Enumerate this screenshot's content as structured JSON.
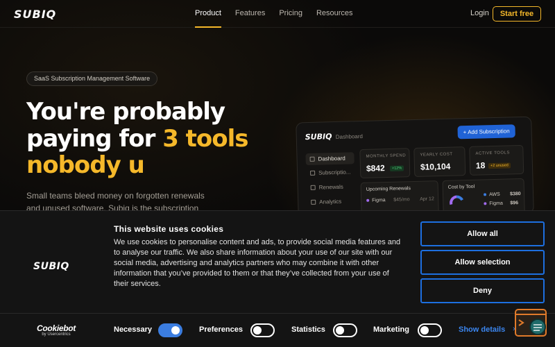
{
  "nav": {
    "logo": "SUBIQ",
    "links": [
      "Product",
      "Features",
      "Pricing",
      "Resources"
    ],
    "active_link": "Product",
    "login": "Login",
    "cta": "Start free"
  },
  "hero": {
    "pill": "SaaS Subscription Management Software",
    "headline_line1": "You're probably",
    "headline_line2_start": "paying for ",
    "headline_line2_highlight": "3 tools",
    "headline_line3": "nobody u",
    "subtext": "Small teams bleed money on forgotten renewals and unused software. Subiq is the subscription"
  },
  "dashboard": {
    "logo": "SUBIQ",
    "title": "Dashboard",
    "add_button": "+ Add Subscription",
    "sidebar": [
      "Dashboard",
      "Subscriptio...",
      "Renewals",
      "Analytics"
    ],
    "cards": [
      {
        "label": "MONTHLY SPEND",
        "value": "$842",
        "badge": "+12%"
      },
      {
        "label": "YEARLY COST",
        "value": "$10,104",
        "badge": ""
      },
      {
        "label": "ACTIVE TOOLS",
        "value": "18",
        "badge": "+2 unused"
      }
    ],
    "upcoming": {
      "title": "Upcoming Renewals",
      "rows": [
        {
          "name": "Figma",
          "price": "$45/mo",
          "date": "Apr 12"
        }
      ]
    },
    "cost_by_tool": {
      "title": "Cost by Tool",
      "rows": [
        {
          "name": "AWS",
          "value": "$380"
        },
        {
          "name": "Figma",
          "value": "$96"
        }
      ]
    }
  },
  "colors": {
    "accent": "#f5b82a",
    "primary_blue": "#1d6fe0",
    "background": "#0b0a09"
  },
  "cookie": {
    "logo": "SUBIQ",
    "title": "This website uses cookies",
    "text": "We use cookies to personalise content and ads, to provide social media features and to analyse our traffic. We also share information about your use of our site with our social media, advertising and analytics partners who may combine it with other information that you’ve provided to them or that they’ve collected from your use of their services.",
    "buttons": {
      "allow_all": "Allow all",
      "allow_selection": "Allow selection",
      "deny": "Deny"
    },
    "cookiebot_main": "Cookiebot",
    "cookiebot_sub": "by Usercentrics",
    "categories": [
      {
        "label": "Necessary",
        "on": true
      },
      {
        "label": "Preferences",
        "on": false
      },
      {
        "label": "Statistics",
        "on": false
      },
      {
        "label": "Marketing",
        "on": false
      }
    ],
    "show_details": "Show details",
    "show_details_chevron": "›"
  }
}
